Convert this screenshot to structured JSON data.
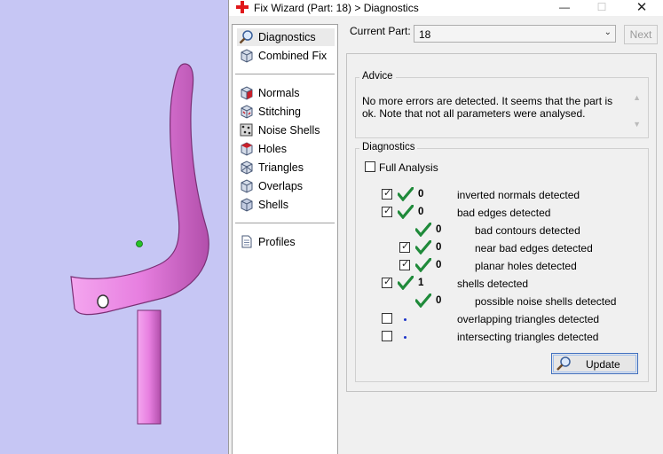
{
  "window": {
    "title": "Fix Wizard (Part: 18) > Diagnostics",
    "minimize": "—",
    "maximize": "☐",
    "close": "✕"
  },
  "nav": {
    "items": [
      {
        "label": "Diagnostics",
        "icon": "magnifier-icon",
        "selected": true
      },
      {
        "label": "Combined Fix",
        "icon": "cube-icon"
      },
      {
        "label": "Normals",
        "icon": "normals-cube-icon"
      },
      {
        "label": "Stitching",
        "icon": "stitching-cube-icon"
      },
      {
        "label": "Noise Shells",
        "icon": "noise-shells-icon"
      },
      {
        "label": "Holes",
        "icon": "holes-cube-icon"
      },
      {
        "label": "Triangles",
        "icon": "triangles-cube-icon"
      },
      {
        "label": "Overlaps",
        "icon": "overlaps-cube-icon"
      },
      {
        "label": "Shells",
        "icon": "shells-cube-icon"
      },
      {
        "label": "Profiles",
        "icon": "document-icon"
      }
    ]
  },
  "current_part": {
    "label": "Current Part:",
    "value": "18",
    "next_label": "Next"
  },
  "advice": {
    "title": "Advice",
    "text": "No more errors are detected. It seems that the part is ok. Note that not all parameters were analysed."
  },
  "diagnostics": {
    "title": "Diagnostics",
    "full_analysis_label": "Full Analysis",
    "full_analysis_checked": false,
    "rows": [
      {
        "checked": true,
        "status": "ok",
        "count": "0",
        "label": "inverted normals detected",
        "level": 0
      },
      {
        "checked": true,
        "status": "ok",
        "count": "0",
        "label": "bad edges detected",
        "level": 0
      },
      {
        "checked": null,
        "status": "ok",
        "count": "0",
        "label": "bad contours detected",
        "level": 1
      },
      {
        "checked": true,
        "status": "ok",
        "count": "0",
        "label": "near bad edges detected",
        "level": 1
      },
      {
        "checked": true,
        "status": "ok",
        "count": "0",
        "label": "planar holes detected",
        "level": 1
      },
      {
        "checked": true,
        "status": "ok",
        "count": "1",
        "label": "shells detected",
        "level": 0
      },
      {
        "checked": null,
        "status": "ok",
        "count": "0",
        "label": "possible noise shells detected",
        "level": 1
      },
      {
        "checked": false,
        "status": "not-run",
        "count": "",
        "label": "overlapping triangles detected",
        "level": 0
      },
      {
        "checked": false,
        "status": "not-run",
        "count": "",
        "label": "intersecting triangles detected",
        "level": 0
      }
    ],
    "update_label": "Update"
  },
  "colors": {
    "viewport_bg": "#c6c6f4",
    "part_fill": "#e77fe0",
    "ok_check": "#1f8a3a",
    "accent_blue": "#3f6fbf"
  }
}
